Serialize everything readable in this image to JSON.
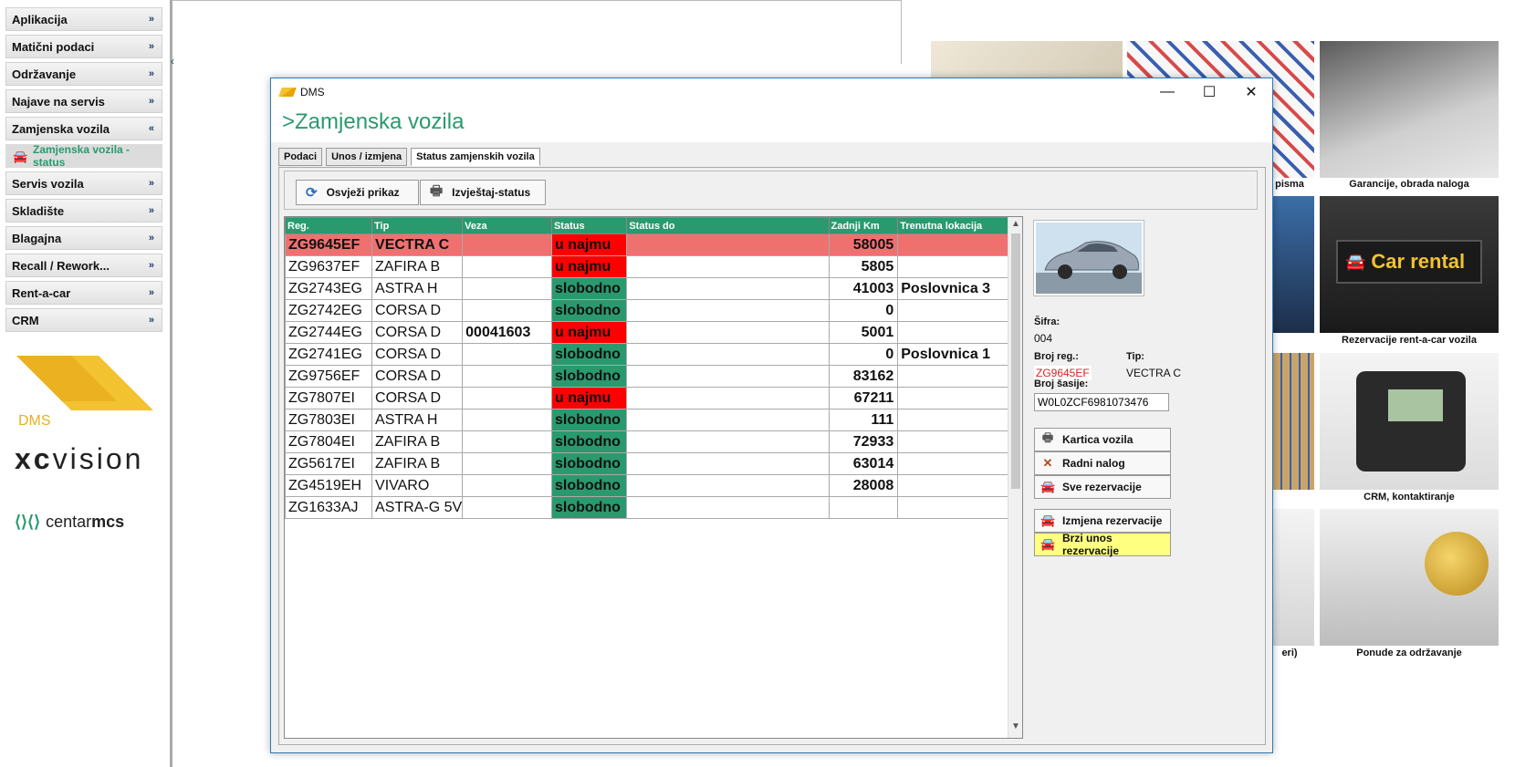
{
  "sidebar": {
    "items": [
      {
        "label": "Aplikacija",
        "chevron": "»"
      },
      {
        "label": "Matični podaci",
        "chevron": "»"
      },
      {
        "label": "Održavanje",
        "chevron": "»"
      },
      {
        "label": "Najave na servis",
        "chevron": "»"
      },
      {
        "label": "Zamjenska vozila",
        "chevron": "«"
      },
      {
        "label": "Servis vozila",
        "chevron": "»"
      },
      {
        "label": "Skladište",
        "chevron": "»"
      },
      {
        "label": "Blagajna",
        "chevron": "»"
      },
      {
        "label": "Recall / Rework...",
        "chevron": "»"
      },
      {
        "label": "Rent-a-car",
        "chevron": "»"
      },
      {
        "label": "CRM",
        "chevron": "»"
      }
    ],
    "sub_item": "Zamjenska vozila - status",
    "logo_dms": "DMS",
    "logo_xc_bold": "xc",
    "logo_xc_light": "vision",
    "logo_centar_light": "centar",
    "logo_centar_bold": "mcs"
  },
  "tiles": {
    "captions": [
      "pisma",
      "Garancije, obrada naloga",
      "Rezervacije rent-a-car vozila",
      "CRM, kontaktiranje",
      "eri)",
      "Ponude za održavanje"
    ],
    "car_rental_sign": "Car rental"
  },
  "window": {
    "title": "DMS",
    "heading": ">Zamjenska vozila",
    "controls": {
      "minimize": "—",
      "maximize": "☐",
      "close": "✕"
    },
    "tabs": [
      "Podaci",
      "Unos / izmjena",
      "Status zamjenskih vozila"
    ],
    "toolbar": {
      "refresh": "Osvježi prikaz",
      "report": "Izvještaj-status"
    }
  },
  "grid": {
    "columns": [
      "Reg.",
      "Tip",
      "Veza",
      "Status",
      "Status do",
      "Zadnji Km",
      "Trenutna lokacija"
    ],
    "rows": [
      {
        "reg": "ZG9645EF",
        "tip": "VECTRA C",
        "veza": "",
        "status": "u najmu",
        "status_do": "",
        "km": "58005",
        "lok": ""
      },
      {
        "reg": "ZG9637EF",
        "tip": "ZAFIRA B",
        "veza": "",
        "status": "u najmu",
        "status_do": "",
        "km": "5805",
        "lok": ""
      },
      {
        "reg": "ZG2743EG",
        "tip": "ASTRA H",
        "veza": "",
        "status": "slobodno",
        "status_do": "",
        "km": "41003",
        "lok": "Poslovnica 3"
      },
      {
        "reg": "ZG2742EG",
        "tip": "CORSA D",
        "veza": "",
        "status": "slobodno",
        "status_do": "",
        "km": "0",
        "lok": ""
      },
      {
        "reg": "ZG2744EG",
        "tip": "CORSA D",
        "veza": "00041603",
        "status": "u najmu",
        "status_do": "",
        "km": "5001",
        "lok": ""
      },
      {
        "reg": "ZG2741EG",
        "tip": "CORSA D",
        "veza": "",
        "status": "slobodno",
        "status_do": "",
        "km": "0",
        "lok": "Poslovnica 1"
      },
      {
        "reg": "ZG9756EF",
        "tip": "CORSA D",
        "veza": "",
        "status": "slobodno",
        "status_do": "",
        "km": "83162",
        "lok": ""
      },
      {
        "reg": "ZG7807EI",
        "tip": "CORSA D",
        "veza": "",
        "status": "u najmu",
        "status_do": "",
        "km": "67211",
        "lok": ""
      },
      {
        "reg": "ZG7803EI",
        "tip": "ASTRA H",
        "veza": "",
        "status": "slobodno",
        "status_do": "",
        "km": "111",
        "lok": ""
      },
      {
        "reg": "ZG7804EI",
        "tip": "ZAFIRA B",
        "veza": "",
        "status": "slobodno",
        "status_do": "",
        "km": "72933",
        "lok": ""
      },
      {
        "reg": "ZG5617EI",
        "tip": "ZAFIRA B",
        "veza": "",
        "status": "slobodno",
        "status_do": "",
        "km": "63014",
        "lok": ""
      },
      {
        "reg": "ZG4519EH",
        "tip": "VIVARO",
        "veza": "",
        "status": "slobodno",
        "status_do": "",
        "km": "28008",
        "lok": ""
      },
      {
        "reg": "ZG1633AJ",
        "tip": "ASTRA-G 5V",
        "veza": "",
        "status": "slobodno",
        "status_do": "",
        "km": "",
        "lok": ""
      }
    ],
    "selected_row": 0
  },
  "details": {
    "sifra_label": "Šifra:",
    "sifra": "004",
    "broj_reg_label": "Broj reg.:",
    "broj_reg": "ZG9645EF",
    "tip_label": "Tip:",
    "tip": "VECTRA C",
    "sasija_label": "Broj šasije:",
    "sasija": "W0L0ZCF6981073476",
    "buttons": [
      "Kartica vozila",
      "Radni nalog",
      "Sve rezervacije",
      "Izmjena rezervacije",
      "Brzi unos rezervacije"
    ]
  },
  "colors": {
    "accent_green": "#2a9a6e",
    "status_rented": "#ff0000",
    "selected_row": "#f07070",
    "highlight_button": "#ffff80"
  }
}
